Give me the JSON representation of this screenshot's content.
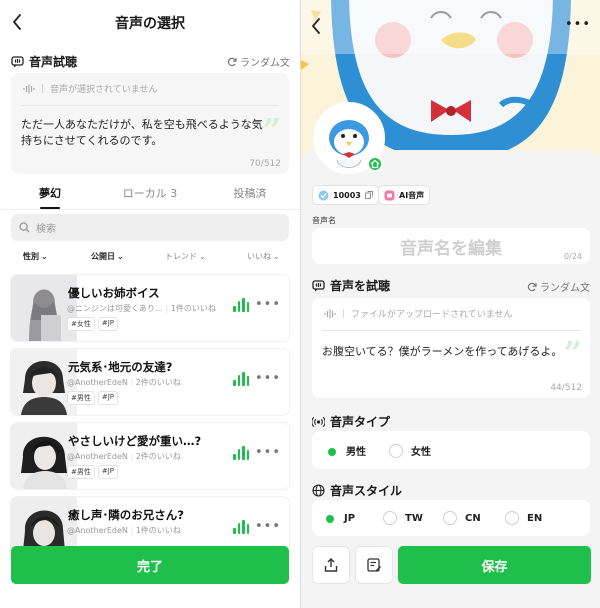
{
  "left": {
    "header": {
      "title": "音声の選択"
    },
    "test": {
      "section_title": "音声試聴",
      "random_label": "ランダム文",
      "placeholder": "音声が選択されていません",
      "text": "ただ一人あなただけが、私を空も飛べるような気持ちにさせてくれるのです。",
      "counter": "70/512"
    },
    "tabs": [
      {
        "label": "夢幻"
      },
      {
        "label": "ローカル 3"
      },
      {
        "label": "投稿済"
      }
    ],
    "search": {
      "placeholder": "検索"
    },
    "filters": [
      {
        "label": "性別"
      },
      {
        "label": "公開日"
      },
      {
        "label": "トレンド"
      },
      {
        "label": "いいね"
      }
    ],
    "voices": [
      {
        "title": "優しいお姉ボイス",
        "author": "@ニンジンは可愛くあり…",
        "likes": "1件のいいね",
        "tags": [
          "#女性",
          "#JP"
        ]
      },
      {
        "title": "元気系･地元の友達?",
        "author": "@AnotherEdeN",
        "likes": "2件のいいね",
        "tags": [
          "#男性",
          "#JP"
        ]
      },
      {
        "title": "やさしいけど愛が重い…?",
        "author": "@AnotherEdeN",
        "likes": "2件のいいね",
        "tags": [
          "#男性",
          "#JP"
        ]
      },
      {
        "title": "癒し声･隣のお兄さん?",
        "author": "@AnotherEdeN",
        "likes": "1件のいいね",
        "tags": []
      }
    ],
    "done_label": "完了"
  },
  "right": {
    "badges": {
      "count": "10003",
      "ai_label": "AI音声"
    },
    "name": {
      "label": "音声名",
      "placeholder": "音声名を編集",
      "counter": "0/24"
    },
    "test": {
      "section_title": "音声を試聴",
      "random_label": "ランダム文",
      "placeholder": "ファイルがアップロードされていません",
      "text": "お腹空いてる？僕がラーメンを作ってあげるよ。",
      "counter": "44/512"
    },
    "type": {
      "title": "音声タイプ",
      "options": [
        "男性",
        "女性"
      ],
      "selected": "男性"
    },
    "style": {
      "title": "音声スタイル",
      "options": [
        "JP",
        "TW",
        "CN",
        "EN"
      ],
      "selected": "JP"
    },
    "save_label": "保存"
  },
  "colors": {
    "accent": "#1fbf4c",
    "background": "#f4f4f5"
  }
}
